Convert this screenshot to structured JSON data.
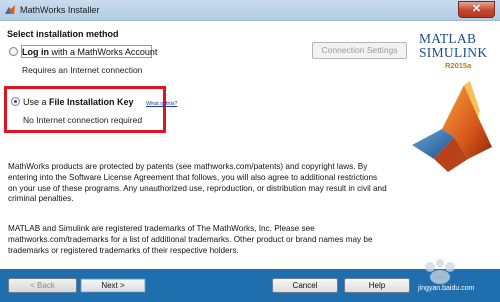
{
  "window": {
    "title": "MathWorks Installer",
    "close_glyph": "✕"
  },
  "install": {
    "heading": "Select installation method",
    "login": {
      "label_bold": "Log in",
      "label_rest": " with a MathWorks Account",
      "sub": "Requires an Internet connection",
      "selected": false
    },
    "connection_button": "Connection Settings",
    "file_key": {
      "label_prefix": "Use a ",
      "label_bold": "File Installation Key",
      "link": "What is this?",
      "sub": "No Internet connection required",
      "selected": true
    }
  },
  "brand": {
    "line1": "MATLAB",
    "line2": "SIMULINK",
    "release": "R2015a"
  },
  "legal": {
    "p1": "MathWorks products are protected by patents (see mathworks.com/patents) and copyright laws. By entering into the Software License Agreement that follows, you will also agree to additional restrictions on your use of these programs. Any unauthorized use, reproduction, or distribution may result in civil and criminal penalties.",
    "p2": "MATLAB and Simulink are registered trademarks of The MathWorks, Inc. Please see mathworks.com/trademarks for a list of additional trademarks. Other product or brand names may be trademarks or registered trademarks of their respective holders."
  },
  "footer": {
    "back": "< Back",
    "next": "Next >",
    "cancel": "Cancel",
    "help": "Help"
  },
  "watermark": {
    "text": "jingyan.baidu.com"
  },
  "colors": {
    "highlight": "#e0141e",
    "footer": "#1f6faf",
    "brand": "#1a4d8c"
  }
}
